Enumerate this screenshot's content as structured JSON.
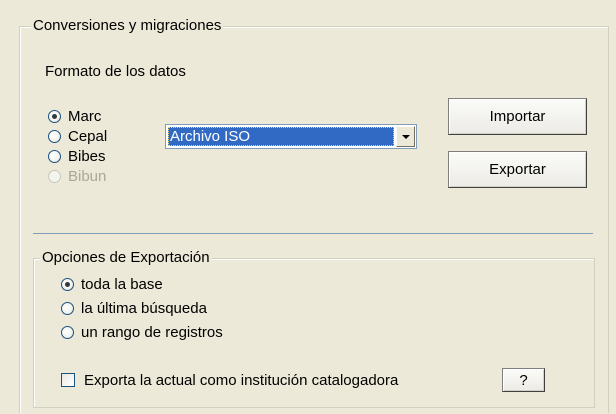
{
  "conversion_group": {
    "title": "Conversiones y migraciones"
  },
  "data_format": {
    "label": "Formato de los datos",
    "options": [
      {
        "label": "Marc",
        "checked": true,
        "disabled": false
      },
      {
        "label": "Cepal",
        "checked": false,
        "disabled": false
      },
      {
        "label": "Bibes",
        "checked": false,
        "disabled": false
      },
      {
        "label": "Bibun",
        "checked": false,
        "disabled": true
      }
    ]
  },
  "file_type_select": {
    "value": "Archivo ISO"
  },
  "buttons": {
    "import": "Importar",
    "export": "Exportar",
    "help": "?"
  },
  "export_options": {
    "title": "Opciones de Exportación",
    "options": [
      {
        "label": "toda la base",
        "checked": true
      },
      {
        "label": "la última búsqueda",
        "checked": false
      },
      {
        "label": "un rango de registros",
        "checked": false
      }
    ],
    "checkbox_label": "Exporta la actual como institución catalogadora",
    "checkbox_checked": false
  },
  "colors": {
    "background": "#ece9d8",
    "selection": "#316ac5",
    "separator": "#7f9db9"
  }
}
